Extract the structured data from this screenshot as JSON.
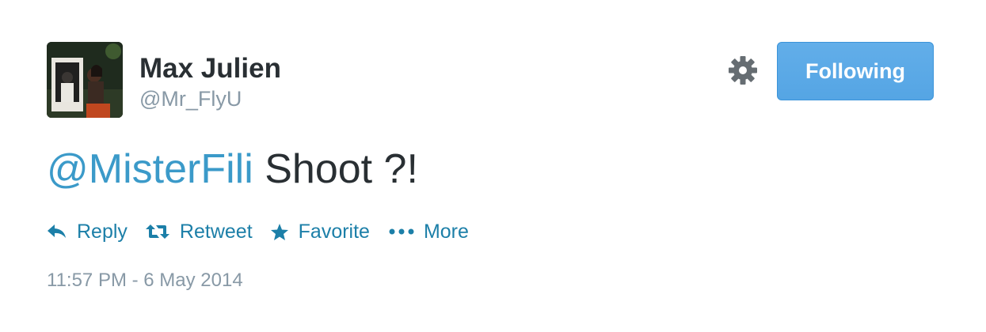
{
  "user": {
    "name": "Max Julien",
    "handle": "@Mr_FlyU"
  },
  "follow_button": {
    "label": "Following"
  },
  "tweet": {
    "mention": "@MisterFili",
    "text": " Shoot ?!"
  },
  "actions": [
    {
      "icon": "reply-icon",
      "label": "Reply"
    },
    {
      "icon": "retweet-icon",
      "label": "Retweet"
    },
    {
      "icon": "star-icon",
      "label": "Favorite"
    },
    {
      "icon": "more-dots-icon",
      "label": "More"
    }
  ],
  "timestamp": "11:57 PM - 6 May 2014",
  "colors": {
    "link": "#1c7fa8",
    "mention": "#3b9ac9",
    "button_bg": "#55a5e4",
    "secondary_text": "#8899a6",
    "primary_text": "#292f33"
  }
}
